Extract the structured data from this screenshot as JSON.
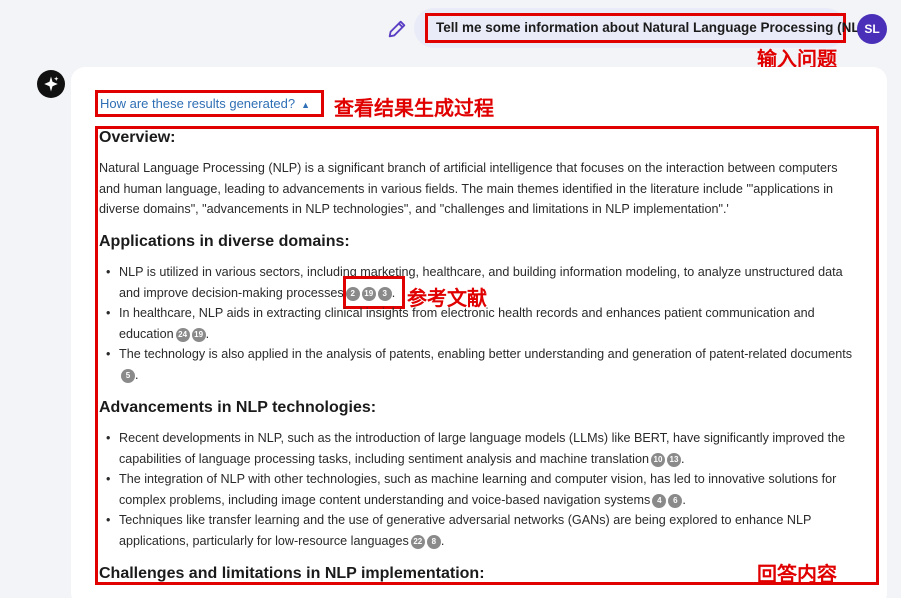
{
  "user": {
    "question": "Tell me some information about Natural Language Processing (NLP).",
    "avatar_initials": "SL",
    "edit_icon": "pencil-icon"
  },
  "annotations": {
    "input": "输入问题",
    "process": "查看结果生成过程",
    "refs": "参考文献",
    "answer": "回答内容"
  },
  "bot": {
    "icon": "sparkle-icon"
  },
  "how_link": {
    "label": "How are these results generated?",
    "icon": "caret-up-icon"
  },
  "answer": {
    "overview_title": "Overview:",
    "overview_text": "Natural Language Processing (NLP) is a significant branch of artificial intelligence that focuses on the interaction between computers and human language, leading to advancements in various fields. The main themes identified in the literature include '\"applications in diverse domains\", \"advancements in NLP technologies\", and \"challenges and limitations in NLP implementation\".'",
    "sections": [
      {
        "title": "Applications in diverse domains:",
        "bullets": [
          {
            "text": "NLP is utilized in various sectors, including marketing, healthcare, and building information modeling, to analyze unstructured data and improve decision-making processes",
            "cites": [
              "2",
              "19",
              "3"
            ]
          },
          {
            "text": "In healthcare, NLP aids in extracting clinical insights from electronic health records and enhances patient communication and education",
            "cites": [
              "24",
              "19"
            ]
          },
          {
            "text": "The technology is also applied in the analysis of patents, enabling better understanding and generation of patent-related documents",
            "cites": [
              "5"
            ]
          }
        ]
      },
      {
        "title": "Advancements in NLP technologies:",
        "bullets": [
          {
            "text": "Recent developments in NLP, such as the introduction of large language models (LLMs) like BERT, have significantly improved the capabilities of language processing tasks, including sentiment analysis and machine translation",
            "cites": [
              "10",
              "13"
            ]
          },
          {
            "text": "The integration of NLP with other technologies, such as machine learning and computer vision, has led to innovative solutions for complex problems, including image content understanding and voice-based navigation systems",
            "cites": [
              "4",
              "6"
            ]
          },
          {
            "text": "Techniques like transfer learning and the use of generative adversarial networks (GANs) are being explored to enhance NLP applications, particularly for low-resource languages",
            "cites": [
              "22",
              "8"
            ]
          }
        ]
      },
      {
        "title": "Challenges and limitations in NLP implementation:",
        "bullets": []
      }
    ],
    "bullet_glyph": "•",
    "period": "."
  }
}
